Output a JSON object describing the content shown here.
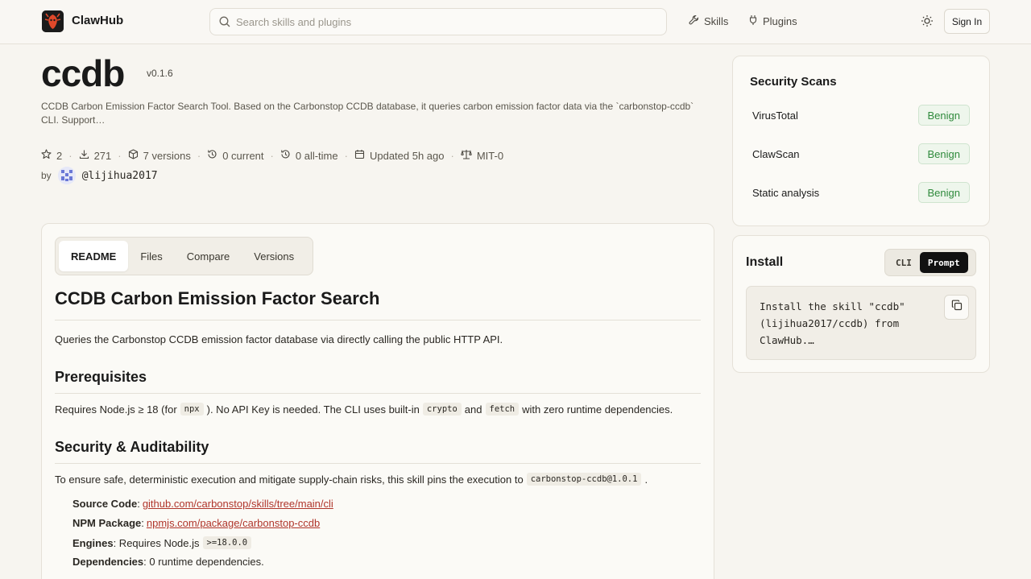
{
  "header": {
    "brand": "ClawHub",
    "search_placeholder": "Search skills and plugins",
    "nav": [
      {
        "label": "Skills",
        "icon": "wrench-icon"
      },
      {
        "label": "Plugins",
        "icon": "plug-icon"
      }
    ],
    "theme_icon": "sun-icon",
    "sign_in": "Sign In"
  },
  "package": {
    "name": "ccdb",
    "version": "v0.1.6",
    "description": "CCDB Carbon Emission Factor Search Tool. Based on the Carbonstop CCDB database, it queries carbon emission factor data via the `carbonstop-ccdb` CLI. Support…",
    "stars": "2",
    "downloads": "271",
    "versions": "7 versions",
    "current": "0 current",
    "all_time": "0 all-time",
    "updated": "Updated 5h ago",
    "license": "MIT-0",
    "by": "by",
    "author": "@lijihua2017"
  },
  "tabs": [
    "README",
    "Files",
    "Compare",
    "Versions"
  ],
  "readme": {
    "h1": "CCDB Carbon Emission Factor Search",
    "intro": "Queries the Carbonstop CCDB emission factor database via directly calling the public HTTP API.",
    "h2_prereq": "Prerequisites",
    "prereq": {
      "p1": "Requires Node.js ≥ 18 (for",
      "c1": "npx",
      "p2": "). No API Key is needed. The CLI uses built-in",
      "c2": "crypto",
      "p3": "and",
      "c3": "fetch",
      "p4": "with zero runtime dependencies."
    },
    "h2_security": "Security & Auditability",
    "security": {
      "p1": "To ensure safe, deterministic execution and mitigate supply-chain risks, this skill pins the execution to",
      "c1": "carbonstop-ccdb@1.0.1",
      "p2": "."
    },
    "list": {
      "source_label": "Source Code",
      "source_link": "github.com/carbonstop/skills/tree/main/cli",
      "npm_label": "NPM Package",
      "npm_link": "npmjs.com/package/carbonstop-ccdb",
      "engines_label": "Engines",
      "engines_text": ": Requires Node.js",
      "engines_code": ">=18.0.0",
      "deps_label": "Dependencies",
      "deps_text": ": 0 runtime dependencies."
    }
  },
  "security_scans": {
    "title": "Security Scans",
    "items": [
      {
        "name": "VirusTotal",
        "status": "Benign"
      },
      {
        "name": "ClawScan",
        "status": "Benign"
      },
      {
        "name": "Static analysis",
        "status": "Benign"
      }
    ]
  },
  "install": {
    "title": "Install",
    "modes": [
      "CLI",
      "Prompt"
    ],
    "active_mode": "Prompt",
    "command": "Install the skill \"ccdb\" (lijihua2017/ccdb) from ClawHub.…"
  },
  "colors": {
    "background": "#f7f5f0",
    "benign_green": "#2f8a3c",
    "link_red": "#b0352b"
  }
}
